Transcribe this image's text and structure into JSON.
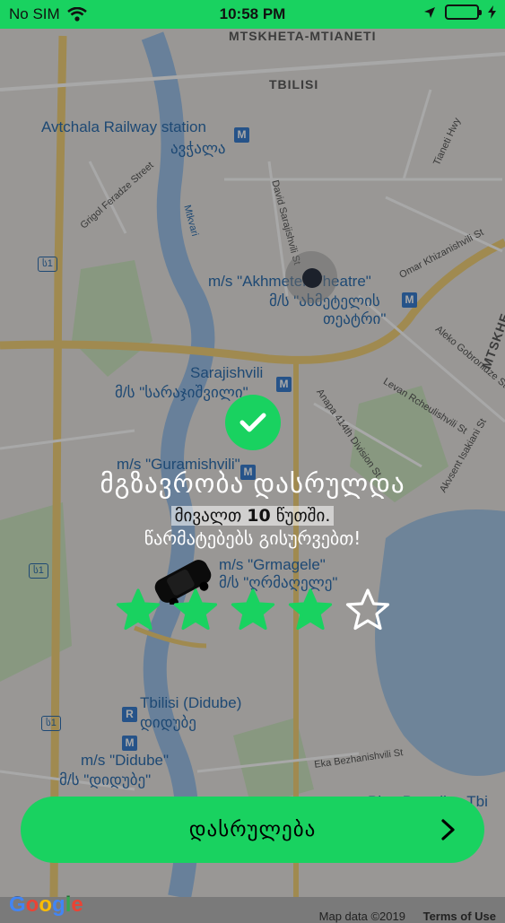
{
  "colors": {
    "accent": "#19d260",
    "star_filled": "#19d260",
    "star_empty": "#ffffff"
  },
  "status_bar": {
    "carrier": "No SIM",
    "time": "10:58 PM"
  },
  "map": {
    "labels": {
      "mtskheta": "MTSKHETA-MTIANETI",
      "tbilisi": "TBILISI",
      "avtchala_en": "Avtchala Railway station",
      "avtchala_ka": "ავჭალა",
      "akhmeteli_en": "m/s \"Akhmeteli Theatre\"",
      "akhmeteli_ka_1": "მ/ს \"ახმეტელის",
      "akhmeteli_ka_2": "თეატრი\"",
      "sarajishvili_en": "Sarajishvili",
      "sarajishvili_ka": "მ/ს \"სარაჯიშვილი\"",
      "guramishvili_en": "m/s \"Guramishvili\"",
      "grmagele_en": "m/s \"Grmagele\"",
      "grmagele_ka": "მ/ს \"ღრმაღელე\"",
      "didube_en": "Tbilisi (Didube)",
      "didube_ka": "დიდუბე",
      "didube_ms_en": "m/s \"Didube\"",
      "didube_ms_ka": "მ/ს \"დიდუბე\"",
      "mtksheta_right": "MTSKHE",
      "tsinandali": "Ping Paradise Tbi",
      "mtkvari": "Mtkvari",
      "s1": "ს1",
      "streets": [
        "Grigol Feradze Street",
        "David Sarajishvili St",
        "Omar Khizanishvili St",
        "Aleko Gobronidze St",
        "Levan Rcheulishvili St",
        "Anapa 414th Division St",
        "Akvsent Isakiani St",
        "Eka Bezhanishvili St",
        "Tianeti Hwy"
      ]
    },
    "google": "Google",
    "map_data": "Map data ©2019",
    "terms": "Terms of Use"
  },
  "overlay": {
    "title": "მგზავრობა დასრულდა",
    "line1_pre": "მივალთ ",
    "line1_num": "10",
    "line1_post": " წუთში.",
    "line2": "წარმატებებს გისურვებთ!"
  },
  "rating": {
    "value": 4,
    "max": 5
  },
  "finish_button": {
    "label": "დასრულება"
  }
}
